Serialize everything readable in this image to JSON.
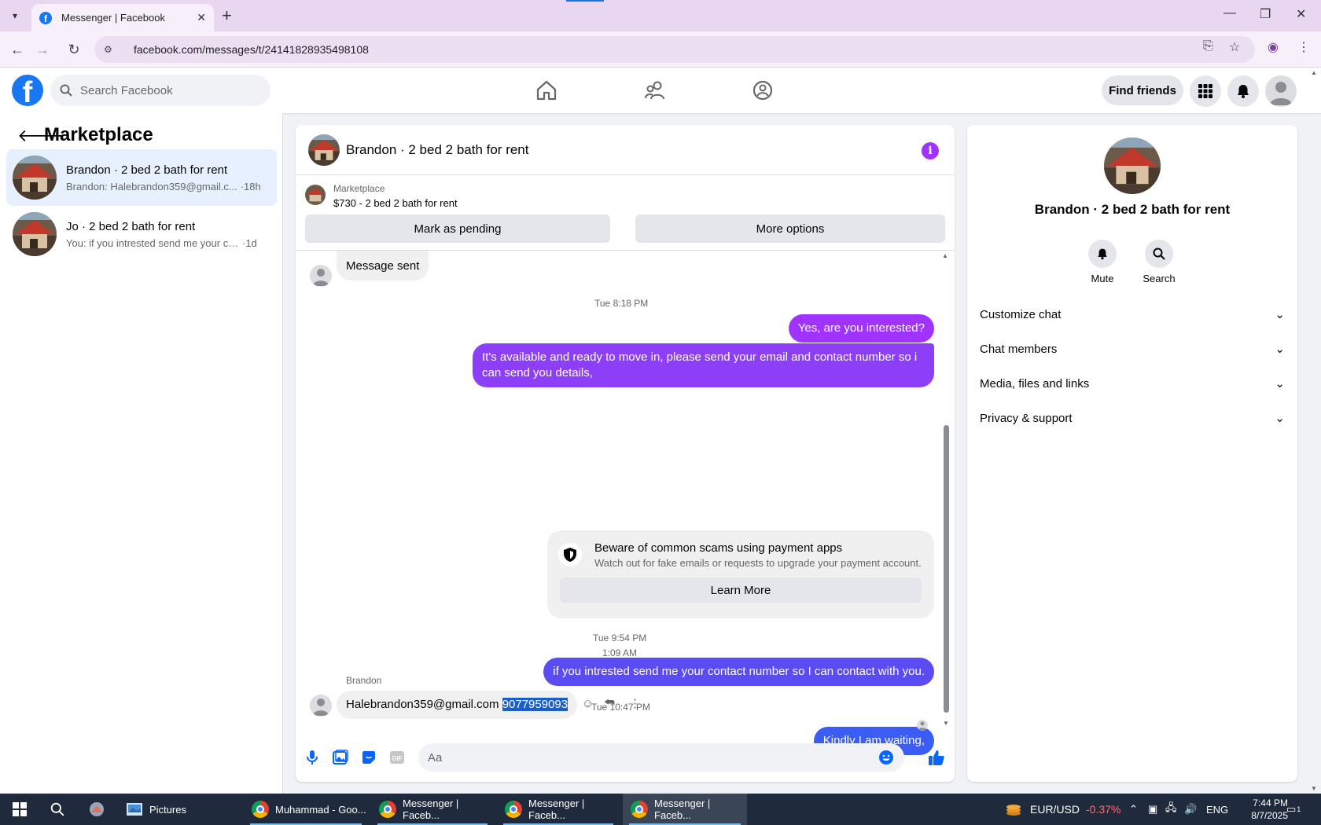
{
  "browser": {
    "tab_title": "Messenger | Facebook",
    "url": "facebook.com/messages/t/24141828935498108",
    "new_tab_symbol": "+"
  },
  "header": {
    "logo_letter": "f",
    "search_placeholder": "Search Facebook",
    "find_friends_label": "Find friends"
  },
  "sidebar": {
    "title": "Marketplace",
    "conversations": [
      {
        "name": "Brandon · 2 bed 2 bath for rent",
        "preview": "Brandon: Halebrandon359@gmail.c...",
        "time": "·18h"
      },
      {
        "name": "Jo · 2 bed 2 bath for rent",
        "preview": "You: if you intrested send me your co...",
        "time": "·1d"
      }
    ]
  },
  "chat": {
    "title": "Brandon · 2 bed 2 bath for rent",
    "listing_source": "Marketplace",
    "listing_price": "$730 - 2 bed 2 bath for rent",
    "mark_pending_label": "Mark as pending",
    "more_options_label": "More options",
    "message_sent": "Message sent",
    "stamp1": "Tue 8:18 PM",
    "out1": "Yes, are you interested?",
    "out2": "It's available and ready to move in, please send your email and contact number so i can send you details,",
    "scam_title": "Beware of common scams using payment apps",
    "scam_desc": "Watch out for fake emails or requests to upgrade your payment account.",
    "learn_more": "Learn More",
    "stamp2": "Tue 9:54 PM",
    "out3": "if you intrested send me your contact number so I can contact with you.",
    "stamp3": "Tue 10:47 PM",
    "out4": "Kindly I am waiting,",
    "stamp4": "1:09 AM",
    "sender": "Brandon",
    "in_email": "Halebrandon359@gmail.com",
    "in_phone": "9077959093",
    "composer_placeholder": "Aa",
    "out_color": "#a033ff",
    "out_color_blue": "#3b5cf5"
  },
  "details": {
    "name": "Brandon · 2 bed 2 bath for rent",
    "mute_label": "Mute",
    "search_label": "Search",
    "sections": [
      "Customize chat",
      "Chat members",
      "Media, files and links",
      "Privacy & support"
    ]
  },
  "taskbar": {
    "pictures_label": "Pictures",
    "app1": "Muhammad - Goo...",
    "app2": "Messenger | Faceb...",
    "app3": "Messenger | Faceb...",
    "app4": "Messenger | Faceb...",
    "ticker": "EUR/USD",
    "ticker_change": "-0.37%",
    "lang": "ENG",
    "time": "7:44 PM",
    "date": "8/7/2025",
    "notif_count": "1"
  }
}
